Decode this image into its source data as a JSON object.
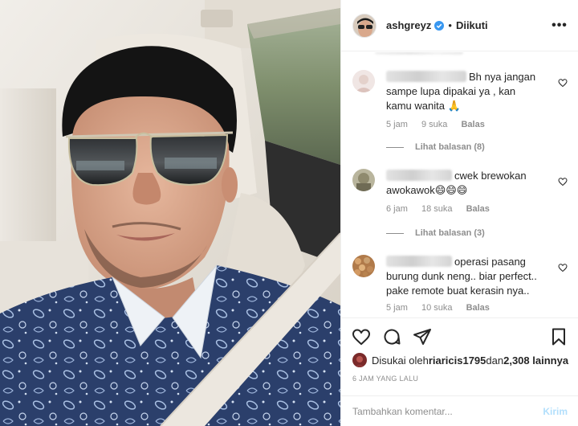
{
  "header": {
    "username": "ashgreyz",
    "separator": "•",
    "follow_status": "Diikuti",
    "more_icon": "ellipsis-icon"
  },
  "comments": [
    {
      "text": "Bh nya jangan sampe lupa dipakai ya , kan kamu wanita 🙏",
      "time": "5 jam",
      "likes": "9 suka",
      "reply": "Balas",
      "view_replies": "Lihat balasan (8)"
    },
    {
      "text": "cwek brewokan awokawok😄😄😄",
      "time": "6 jam",
      "likes": "18 suka",
      "reply": "Balas",
      "view_replies": "Lihat balasan (3)"
    },
    {
      "text": "operasi pasang burung dunk neng.. biar perfect.. pake remote buat kerasin nya..",
      "time": "5 jam",
      "likes": "10 suka",
      "reply": "Balas"
    }
  ],
  "liked_by": {
    "prefix": "Disukai oleh ",
    "user": "riaricis1795",
    "middle": " dan ",
    "count": "2,308 lainnya"
  },
  "post_time": "6 JAM YANG LALU",
  "add_comment": {
    "placeholder": "Tambahkan komentar...",
    "post_label": "Kirim"
  },
  "colors": {
    "text": "#262626",
    "secondary": "#8e8e8e",
    "verified": "#3897f0",
    "post_disabled": "#b2dffc",
    "border": "#efefef"
  }
}
